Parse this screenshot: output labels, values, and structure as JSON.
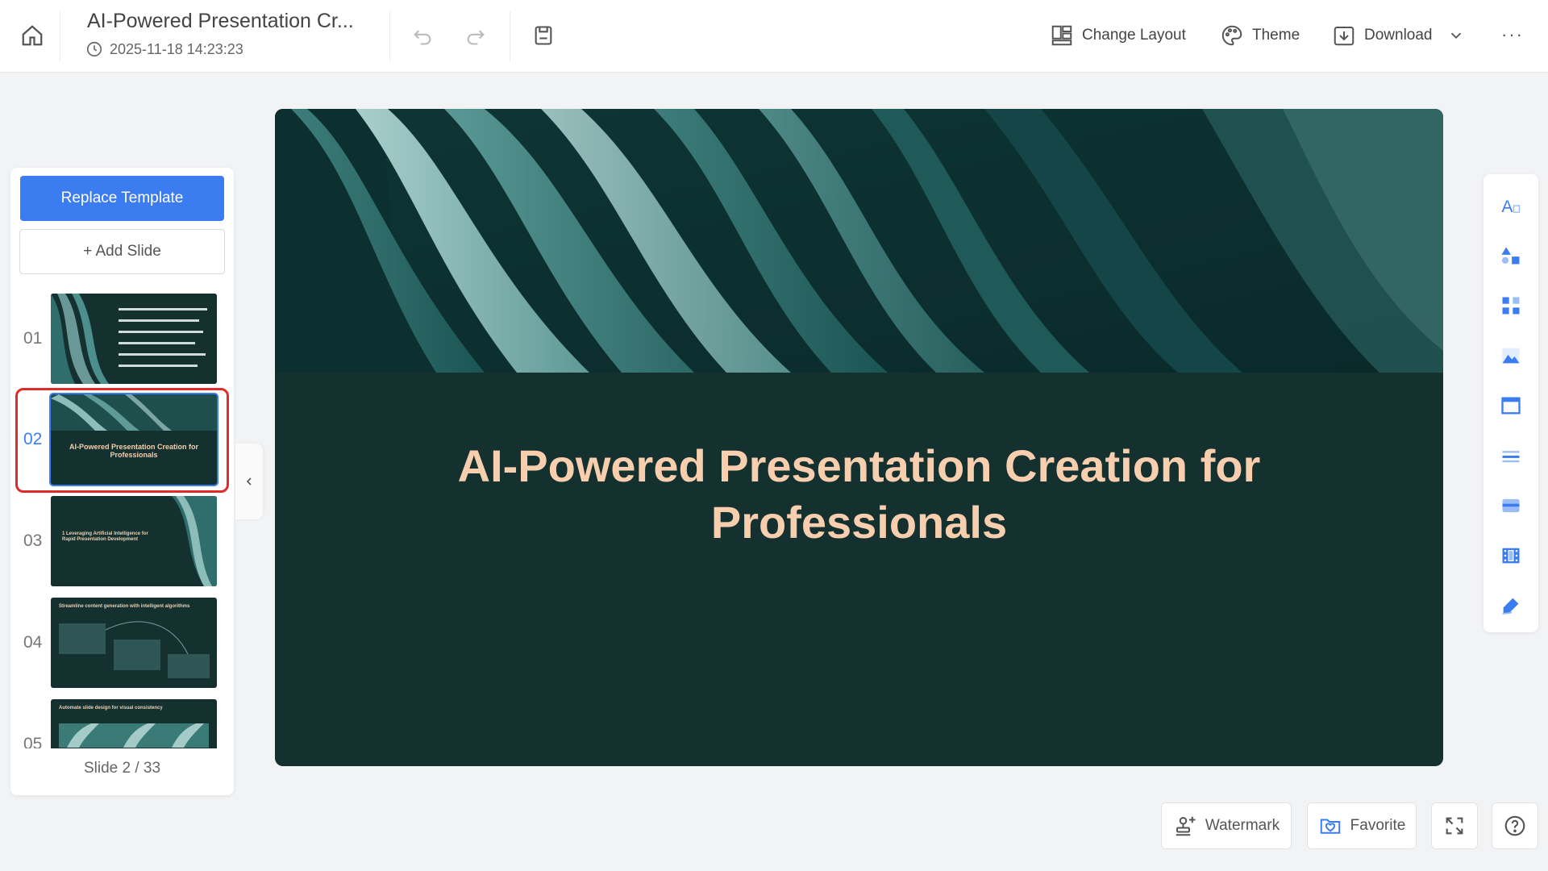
{
  "header": {
    "doc_title": "AI-Powered Presentation Cr...",
    "timestamp": "2025-11-18 14:23:23",
    "buttons": {
      "change_layout": "Change Layout",
      "theme": "Theme",
      "download": "Download"
    },
    "more": "···"
  },
  "sidebar": {
    "replace_template": "Replace Template",
    "add_slide": "+ Add Slide",
    "slides": [
      {
        "num": "01",
        "label": ""
      },
      {
        "num": "02",
        "label": "AI-Powered Presentation Creation for Professionals"
      },
      {
        "num": "03",
        "label": "1 Leveraging Artificial Intelligence for Rapid Presentation Development"
      },
      {
        "num": "04",
        "label": "Streamline content generation with intelligent algorithms"
      },
      {
        "num": "05",
        "label": "Automate slide design for visual consistency"
      }
    ],
    "counter": "Slide 2 / 33",
    "active_index": 1
  },
  "canvas": {
    "title_line1": "AI-Powered Presentation Creation for",
    "title_line2": "Professionals",
    "bg_color": "#14302f",
    "title_color": "#f7cfae"
  },
  "footer": {
    "watermark": "Watermark",
    "favorite": "Favorite"
  },
  "colors": {
    "accent": "#3b7cf0",
    "selection": "#e02b2b"
  }
}
